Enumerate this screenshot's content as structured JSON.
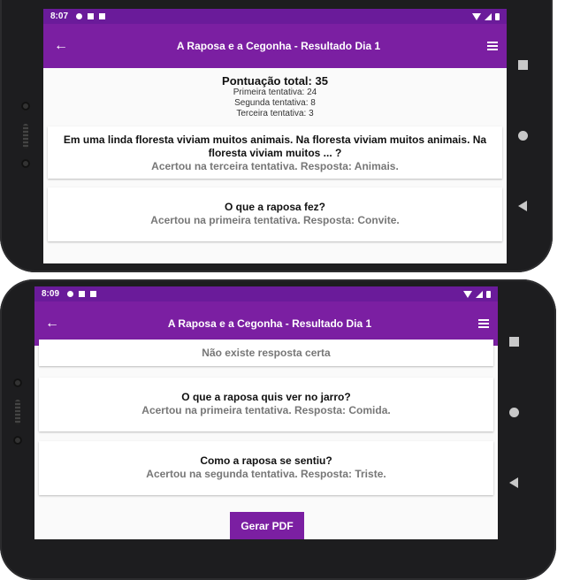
{
  "top_screen": {
    "status_time": "8:07",
    "title": "A Raposa e a Cegonha - Resultado Dia 1",
    "score": {
      "total": "Pontuação total: 35",
      "first": "Primeira tentativa: 24",
      "second": "Segunda tentativa: 8",
      "third": "Terceira tentativa: 3"
    },
    "cards": [
      {
        "question": "Em uma linda floresta viviam muitos animais. Na floresta viviam muitos animais. Na floresta viviam muitos ... ?",
        "answer": "Acertou na terceira tentativa. Resposta: Animais."
      },
      {
        "question": "O que a raposa fez?",
        "answer": "Acertou na primeira tentativa. Resposta: Convite."
      }
    ]
  },
  "bottom_screen": {
    "status_time": "8:09",
    "title": "A Raposa e a Cegonha - Resultado Dia 1",
    "partial_answer": "Não existe resposta certa",
    "cards": [
      {
        "question": "O que a raposa quis ver no jarro?",
        "answer": "Acertou na primeira tentativa. Resposta: Comida."
      },
      {
        "question": "Como a raposa se sentiu?",
        "answer": "Acertou na segunda tentativa. Resposta: Triste."
      }
    ],
    "pdf_button": "Gerar PDF"
  },
  "icons": [
    "back-arrow-icon",
    "menu-icon",
    "wifi-icon",
    "signal-icon",
    "battery-icon",
    "settings-icon",
    "square-nav-icon",
    "circle-nav-icon",
    "triangle-nav-icon"
  ],
  "colors": {
    "appbar": "#7b1fa2",
    "statusbar": "#6a1b9a",
    "answer_text": "#777777"
  }
}
